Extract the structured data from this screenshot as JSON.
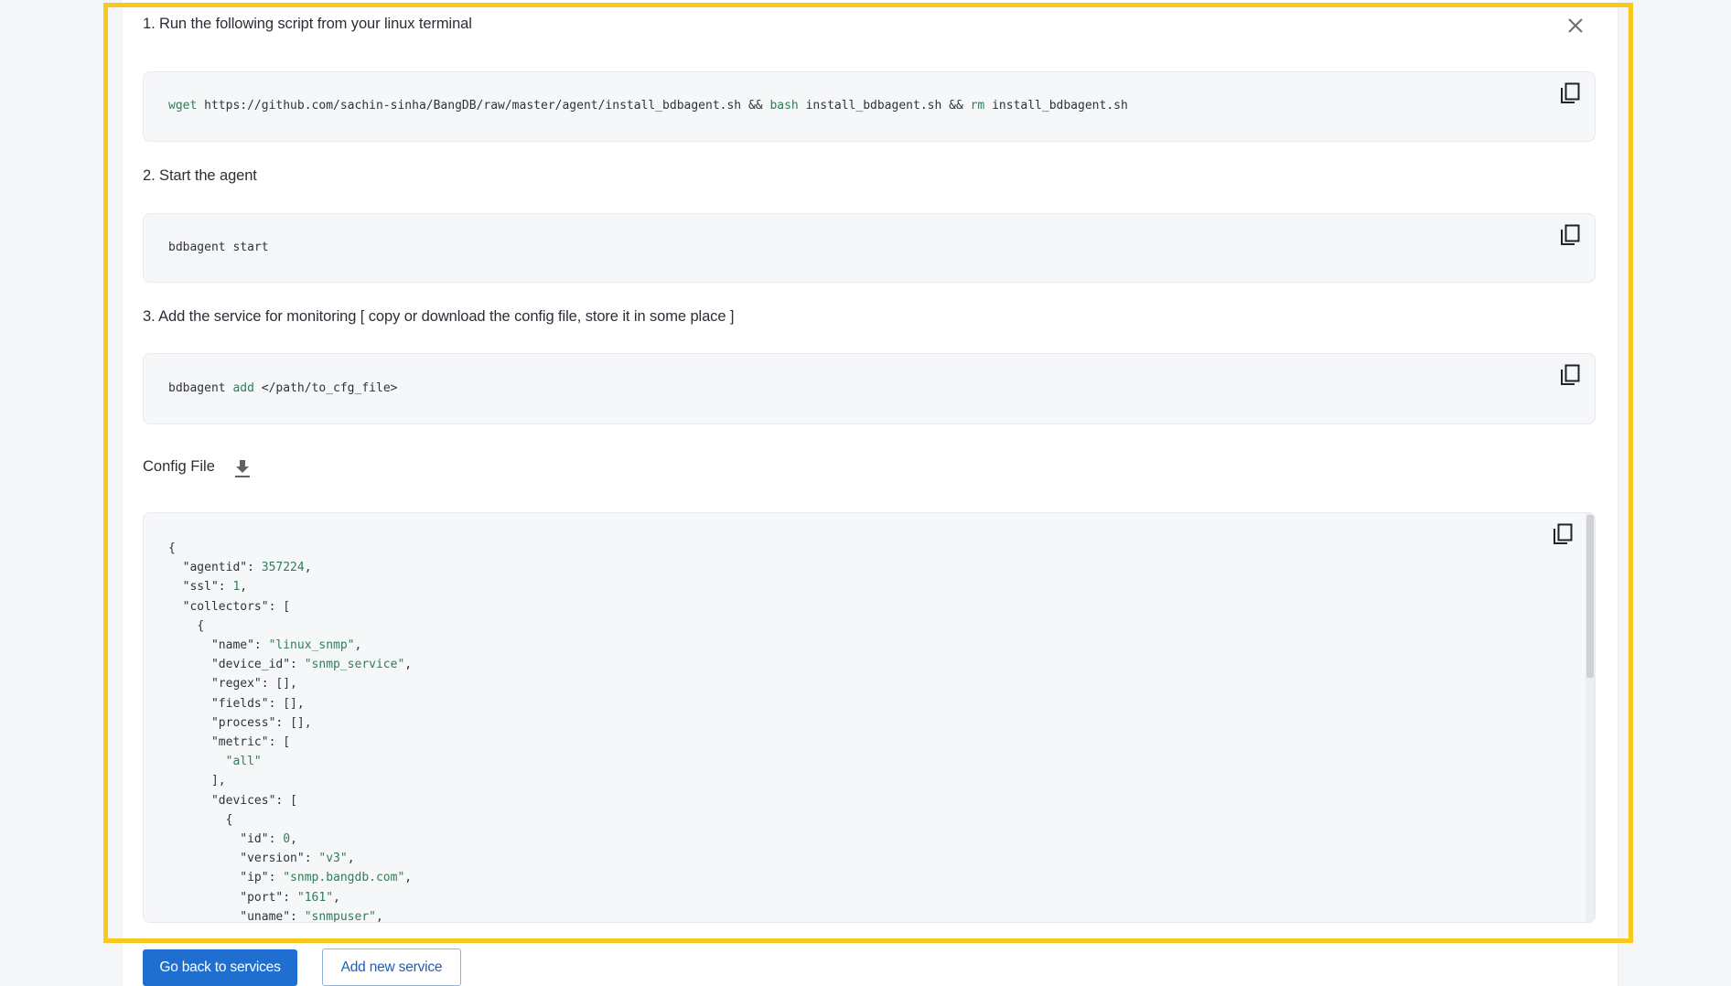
{
  "colors": {
    "highlight": "#f8c81c",
    "primary": "#1e6fd0",
    "keyword": "#2f7d55"
  },
  "steps": [
    {
      "label": "1. Run the following script from your linux terminal",
      "code": {
        "cmd1": "wget",
        "arg1": " https://github.com/sachin-sinha/BangDB/raw/master/agent/install_bdbagent.sh && ",
        "cmd2": "bash",
        "arg2": " install_bdbagent.sh && ",
        "cmd3": "rm",
        "arg3": " install_bdbagent.sh"
      },
      "copy_icon": "copy-icon"
    },
    {
      "label": "2. Start the agent",
      "code": {
        "text": "bdbagent start"
      },
      "copy_icon": "copy-icon"
    },
    {
      "label": "3. Add the service for monitoring [ copy or download the config file, store it in some place ]",
      "code": {
        "cmd": "bdbagent ",
        "kw": "add",
        "arg": " </path/to_cfg_file>"
      },
      "copy_icon": "copy-icon"
    }
  ],
  "config": {
    "label": "Config File",
    "download_icon": "download-icon",
    "copy_icon": "copy-icon",
    "lines": [
      {
        "indent": "",
        "key": "",
        "value": "{",
        "type": "plain"
      },
      {
        "indent": "  ",
        "key": "\"agentid\": ",
        "value": "357224",
        "suffix": ",",
        "type": "num"
      },
      {
        "indent": "  ",
        "key": "\"ssl\": ",
        "value": "1",
        "suffix": ",",
        "type": "num"
      },
      {
        "indent": "  ",
        "key": "\"collectors\": ",
        "value": "[",
        "type": "plain"
      },
      {
        "indent": "    ",
        "key": "",
        "value": "{",
        "type": "plain"
      },
      {
        "indent": "      ",
        "key": "\"name\": ",
        "value": "\"linux_snmp\"",
        "suffix": ",",
        "type": "str"
      },
      {
        "indent": "      ",
        "key": "\"device_id\": ",
        "value": "\"snmp_service\"",
        "suffix": ",",
        "type": "str"
      },
      {
        "indent": "      ",
        "key": "\"regex\": ",
        "value": "[],",
        "type": "plain"
      },
      {
        "indent": "      ",
        "key": "\"fields\": ",
        "value": "[],",
        "type": "plain"
      },
      {
        "indent": "      ",
        "key": "\"process\": ",
        "value": "[],",
        "type": "plain"
      },
      {
        "indent": "      ",
        "key": "\"metric\": ",
        "value": "[",
        "type": "plain"
      },
      {
        "indent": "        ",
        "key": "",
        "value": "\"all\"",
        "type": "str"
      },
      {
        "indent": "      ",
        "key": "",
        "value": "],",
        "type": "plain"
      },
      {
        "indent": "      ",
        "key": "\"devices\": ",
        "value": "[",
        "type": "plain"
      },
      {
        "indent": "        ",
        "key": "",
        "value": "{",
        "type": "plain"
      },
      {
        "indent": "          ",
        "key": "\"id\": ",
        "value": "0",
        "suffix": ",",
        "type": "num"
      },
      {
        "indent": "          ",
        "key": "\"version\": ",
        "value": "\"v3\"",
        "suffix": ",",
        "type": "str"
      },
      {
        "indent": "          ",
        "key": "\"ip\": ",
        "value": "\"snmp.bangdb.com\"",
        "suffix": ",",
        "type": "str"
      },
      {
        "indent": "          ",
        "key": "\"port\": ",
        "value": "\"161\"",
        "suffix": ",",
        "type": "str"
      },
      {
        "indent": "          ",
        "key": "\"uname\": ",
        "value": "\"snmpuser\"",
        "suffix": ",",
        "type": "str"
      }
    ]
  },
  "actions": {
    "back_label": "Go back to services",
    "add_label": "Add new service"
  }
}
